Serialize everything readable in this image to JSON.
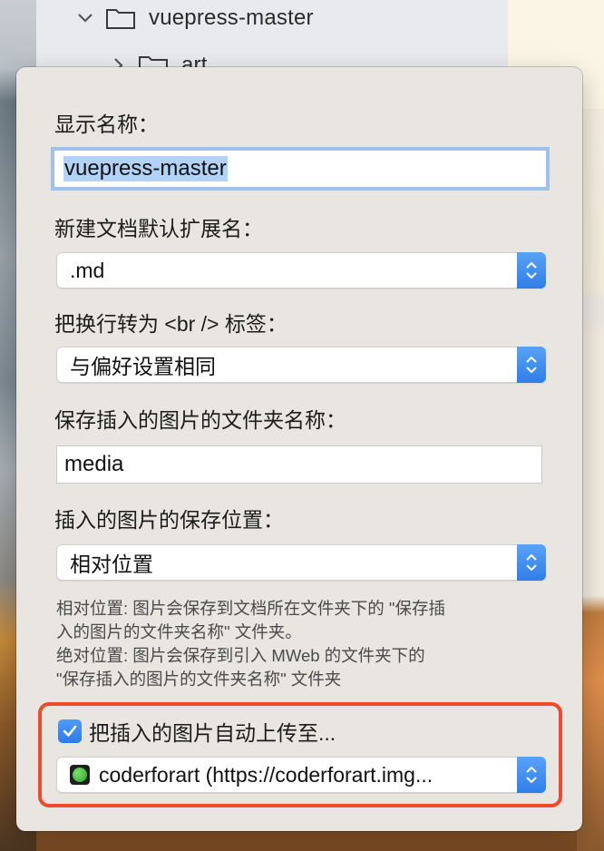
{
  "tree": {
    "root_folder": "vuepress-master",
    "child_folder": "art"
  },
  "popover": {
    "display_name_label": "显示名称：",
    "display_name_value": "vuepress-master",
    "ext_label": "新建文档默认扩展名：",
    "ext_value": ".md",
    "br_label": "把换行转为 <br /> 标签：",
    "br_value": "与偏好设置相同",
    "folder_name_label": "保存插入的图片的文件夹名称：",
    "folder_name_value": "media",
    "save_location_label": "插入的图片的保存位置：",
    "save_location_value": "相对位置",
    "hint_line1": "相对位置: 图片会保存到文档所在文件夹下的 \"保存插",
    "hint_line2": "入的图片的文件夹名称\" 文件夹。",
    "hint_line3": "绝对位置: 图片会保存到引入 MWeb 的文件夹下的",
    "hint_line4": "\"保存插入的图片的文件夹名称\" 文件夹",
    "auto_upload_label": "把插入的图片自动上传至...",
    "auto_upload_checked": true,
    "upload_service_value": "coderforart (https://coderforart.img..."
  },
  "colors": {
    "accent": "#2f7fe9",
    "highlight": "#ef4a2b"
  }
}
